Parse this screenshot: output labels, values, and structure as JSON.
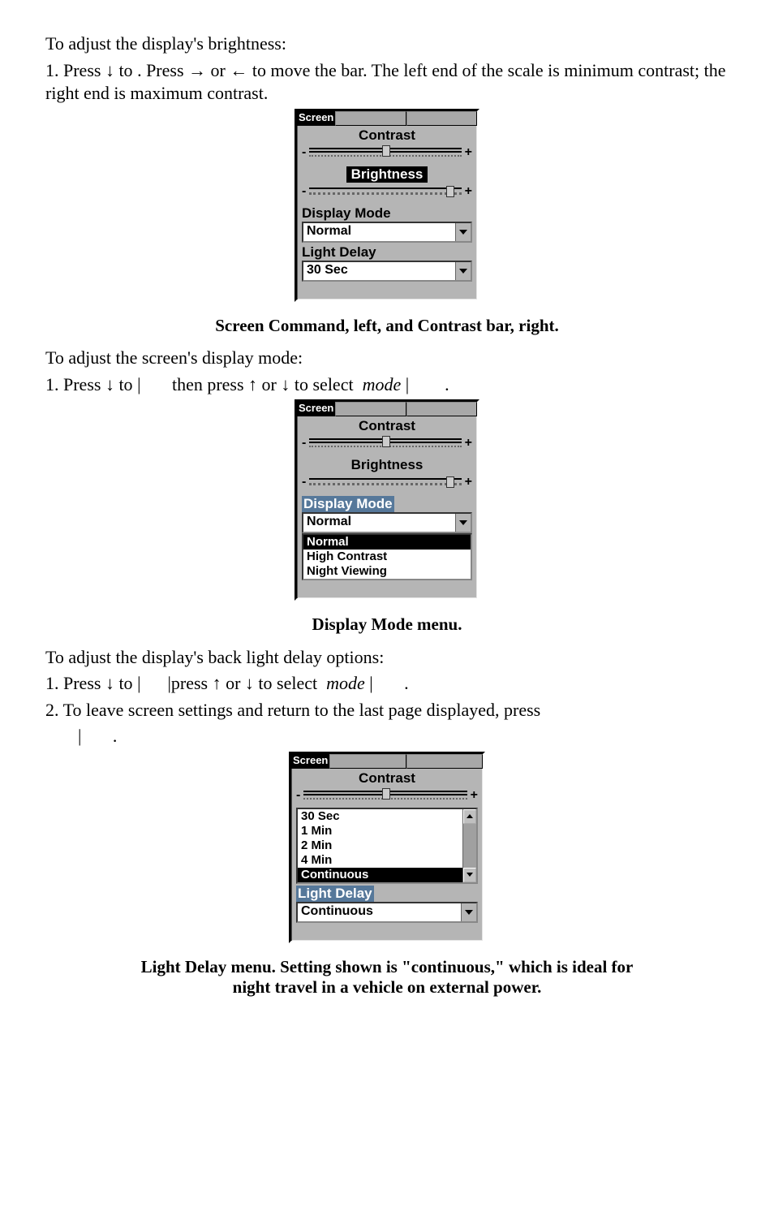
{
  "p1a": "To adjust the display's brightness:",
  "p1b_pre": "1. Press ↓ to ",
  "p1b_mid": ". Press → or ← to move the bar. The left end of the scale is minimum contrast; the right end is maximum contrast.",
  "caption1": "Screen Command, left, and Contrast bar, right.",
  "p2a": "To adjust the screen's display mode:",
  "p2b_pre": "1. Press ↓ to ",
  "p2b_mid": "|       then press ↑ or ↓ to select ",
  "p2b_mode": "mode",
  "p2b_end": "|        .",
  "caption2": "Display Mode menu.",
  "p3a": "To adjust the display's back light delay options:",
  "p3b_pre": "1. Press ↓ to ",
  "p3b_mid": "|      |press ↑ or ↓ to select ",
  "p3b_mode": "mode",
  "p3b_end": "|       .",
  "p4": "2. To leave screen settings and return to the last page displayed, press",
  "p4b": "|       .",
  "caption3a": "Light Delay menu. Setting shown is \"continuous,\" which is ideal for",
  "caption3b": "night travel in a vehicle on external power.",
  "ui": {
    "tab": "Screen",
    "contrast": "Contrast",
    "brightness": "Brightness",
    "display_mode": "Display Mode",
    "light_delay": "Light Delay",
    "normal": "Normal",
    "thirty": "30 Sec",
    "mode_opts": [
      "Normal",
      "High Contrast",
      "Night Viewing"
    ],
    "delay_opts": [
      "30 Sec",
      "1 Min",
      "2 Min",
      "4 Min",
      "Continuous"
    ],
    "continuous": "Continuous"
  },
  "chart_data": {
    "type": "table",
    "note": "Three UI panel figures from a grayscale device manual showing a Screen settings dialog.",
    "figures": [
      {
        "id": 1,
        "caption": "Screen Command, left, and Contrast bar, right.",
        "active_tab": "Screen",
        "sliders": [
          {
            "label": "Contrast",
            "selected": false,
            "approx_value_pct": 50
          },
          {
            "label": "Brightness",
            "selected": true,
            "approx_value_pct": 95
          }
        ],
        "dropdowns": [
          {
            "label": "Display Mode",
            "value": "Normal"
          },
          {
            "label": "Light Delay",
            "value": "30 Sec"
          }
        ]
      },
      {
        "id": 2,
        "caption": "Display Mode menu.",
        "active_tab": "Screen",
        "sliders": [
          {
            "label": "Contrast",
            "selected": false,
            "approx_value_pct": 50
          },
          {
            "label": "Brightness",
            "selected": false,
            "approx_value_pct": 95
          }
        ],
        "highlighted_label": "Display Mode",
        "dropdown_open": {
          "label": "Display Mode",
          "visible_value": "Normal",
          "options": [
            "Normal",
            "High Contrast",
            "Night Viewing"
          ],
          "selected_option": "Normal"
        }
      },
      {
        "id": 3,
        "caption": "Light Delay menu. Setting shown is \"continuous,\" which is ideal for night travel in a vehicle on external power.",
        "active_tab": "Screen",
        "sliders": [
          {
            "label": "Contrast",
            "selected": false,
            "approx_value_pct": 50
          }
        ],
        "listbox": {
          "options": [
            "30 Sec",
            "1 Min",
            "2 Min",
            "4 Min",
            "Continuous"
          ],
          "selected_option": "Continuous",
          "scrollbar": true
        },
        "highlighted_label": "Light Delay",
        "dropdowns": [
          {
            "label": "Light Delay",
            "value": "Continuous"
          }
        ]
      }
    ]
  }
}
